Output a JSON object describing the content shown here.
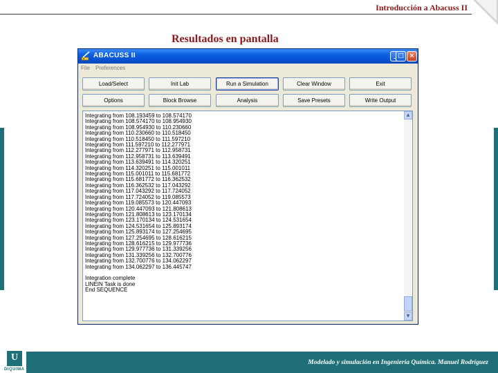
{
  "slide": {
    "header": "Introducción a Abacuss II",
    "title": "Resultados en pantalla",
    "footer": "Modelado y simulación en Ingeniería Química.  Manuel Rodríguez",
    "logo_text": "DIQUIMA",
    "accent_color": "#1e6f78",
    "title_color": "#8b1a1a"
  },
  "window": {
    "title": "ABACUSS II",
    "controls": {
      "minimize": "_",
      "maximize": "□",
      "close": "×"
    },
    "menu": [
      "File",
      "Preferences"
    ]
  },
  "buttons": {
    "row1": [
      "Load/Select",
      "Init Lab",
      "Run a Simulation",
      "Clear Window",
      "Exit"
    ],
    "row2": [
      "Options",
      "Block Browse",
      "Analysis",
      "Save Presets",
      "Write Output"
    ]
  },
  "output_lines": [
    "Integrating from 108.193459 to 108.574170",
    "Integrating from 108.574170 to 108.954930",
    "Integrating from 108.954930 to 110.230660",
    "Integrating from 110.230660 to 110.518450",
    "Integrating from 110.518450 to 111.597210",
    "Integrating from 111.597210 to 112.277971",
    "Integrating from 112.277971 to 112.958731",
    "Integrating from 112.958731 to 113.639491",
    "Integrating from 113.639491 to 114.320251",
    "Integrating from 114.320251 to 115.001011",
    "Integrating from 115.001011 to 115.681772",
    "Integrating from 115.681772 to 116.362532",
    "Integrating from 116.362532 to 117.043292",
    "Integrating from 117.043292 to 117.724052",
    "Integrating from 117.724052 to 119.085573",
    "Integrating from 119.085573 to 120.447093",
    "Integrating from 120.447093 to 121.808613",
    "Integrating from 121.808613 to 123.170134",
    "Integrating from 123.170134 to 124.531654",
    "Integrating from 124.531654 to 125.893174",
    "Integrating from 125.893174 to 127.254695",
    "Integrating from 127.254695 to 128.616215",
    "Integrating from 128.616215 to 129.977736",
    "Integrating from 129.977736 to 131.339256",
    "Integrating from 131.339256 to 132.700776",
    "Integrating from 132.700776 to 134.062297",
    "Integrating from 134.062297 to 136.445747",
    "",
    "Integration complete",
    "LINEIN Task is done",
    "End SEQUENCE"
  ]
}
